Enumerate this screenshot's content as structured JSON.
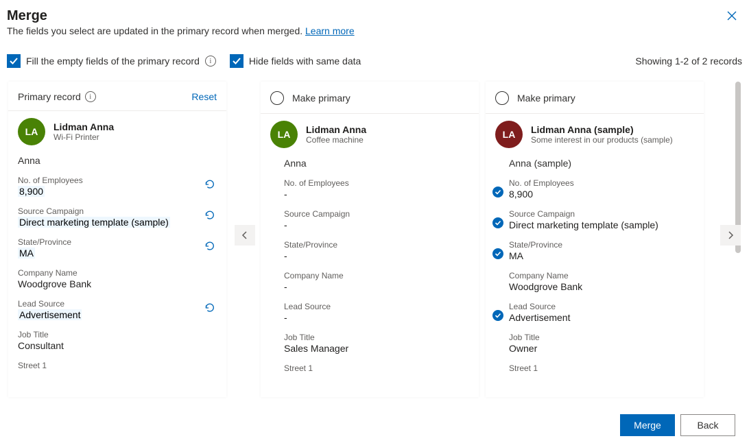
{
  "title": "Merge",
  "subtitle_prefix": "The fields you select are updated in the primary record when merged. ",
  "learn_more": "Learn more",
  "options": {
    "fill_empty": "Fill the empty fields of the primary record",
    "hide_same": "Hide fields with same data"
  },
  "records_count": "Showing 1-2 of 2 records",
  "labels": {
    "primary_record": "Primary record",
    "reset": "Reset",
    "make_primary": "Make primary"
  },
  "fields": {
    "no_employees": "No. of Employees",
    "source_campaign": "Source Campaign",
    "state": "State/Province",
    "company": "Company Name",
    "lead_source": "Lead Source",
    "job_title": "Job Title",
    "street1": "Street 1"
  },
  "primary": {
    "initials": "LA",
    "name": "Lidman Anna",
    "sub": "Wi-Fi Printer",
    "topic": "Anna",
    "no_employees": "8,900",
    "source_campaign": "Direct marketing template (sample)",
    "state": "MA",
    "company": "Woodgrove Bank",
    "lead_source": "Advertisement",
    "job_title": "Consultant",
    "street1": ""
  },
  "record2": {
    "initials": "LA",
    "name": "Lidman Anna",
    "sub": "Coffee machine",
    "topic": "Anna",
    "no_employees": "-",
    "source_campaign": "-",
    "state": "-",
    "company": "-",
    "lead_source": "-",
    "job_title": "Sales Manager",
    "street1": ""
  },
  "record3": {
    "initials": "LA",
    "name": "Lidman Anna (sample)",
    "sub": "Some interest in our products (sample)",
    "topic": "Anna (sample)",
    "no_employees": "8,900",
    "source_campaign": "Direct marketing template (sample)",
    "state": "MA",
    "company": "Woodgrove Bank",
    "lead_source": "Advertisement",
    "job_title": "Owner",
    "street1": ""
  },
  "buttons": {
    "merge": "Merge",
    "back": "Back"
  }
}
